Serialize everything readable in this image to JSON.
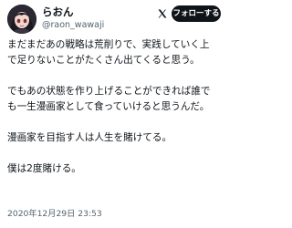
{
  "author": {
    "display_name": "らおん",
    "handle": "@raon_wawaji"
  },
  "follow_button": {
    "label": "フォローする"
  },
  "icons": {
    "logo": "x-logo-icon",
    "avatar": "anime-avatar"
  },
  "tweet": {
    "paragraphs": [
      "まだまだあの戦略は荒削りで、実践していく上で足りないことがたくさん出てくると思う。",
      "でもあの状態を作り上げることができれば誰でも一生漫画家として食っていけると思うんだ。",
      "漫画家を目指す人は人生を賭けてる。",
      "僕は2度賭ける。"
    ],
    "timestamp": "2020年12月29日 23:53"
  }
}
